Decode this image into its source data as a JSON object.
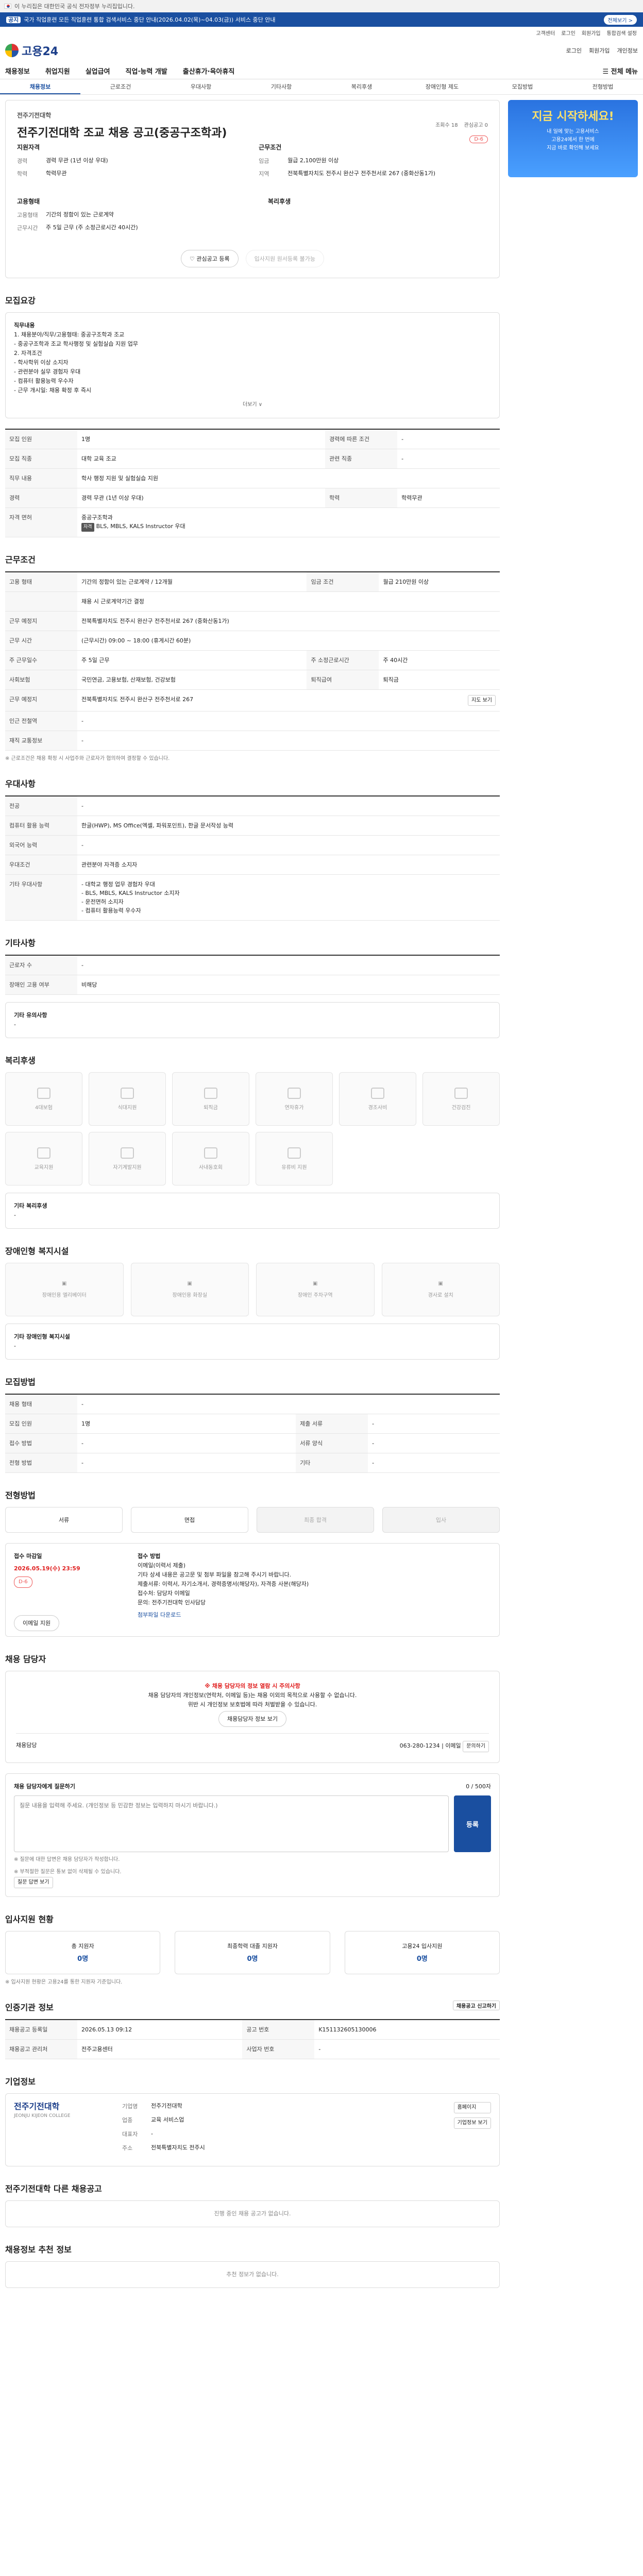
{
  "gov_bar": {
    "text": "이 누리집은 대한민국 공식 전자정부 누리집입니다."
  },
  "notice": {
    "tag": "공지",
    "text": "국가 직업훈련 모든 직업훈련 통합 검색서비스 중단 안내(2026.04.02(목)~04.03(금)) 서비스 중단 안내",
    "btn": "전체보기 >"
  },
  "util": [
    "고객센터",
    "로그인",
    "회원가입",
    "통합검색 설정"
  ],
  "logo": "고용24",
  "header_right": [
    "로그인",
    "회원가입",
    "개인정보"
  ],
  "gnb": {
    "items": [
      "채용정보",
      "취업지원",
      "실업급여",
      "직업·능력 개발",
      "출산휴가·육아휴직"
    ],
    "all": "전체 메뉴"
  },
  "subnav": [
    "채용정보",
    "근로조건",
    "우대사항",
    "기타사항",
    "복리후생",
    "장애인형 제도",
    "모집방법",
    "전형방법"
  ],
  "side_banner": {
    "title": "지금 시작하세요!",
    "lines": [
      "내 일에 맞는 고용서비스",
      "고용24에서 한 번에",
      "지금 바로 확인해 보세요"
    ]
  },
  "job": {
    "company": "전주기전대학",
    "title": "전주기전대학 조교 채용 공고(중공구조학과)",
    "views_label": "조회수",
    "views": "18",
    "scrap_label": "관심공고",
    "scrap": "0",
    "dday": "D-6",
    "left_head": "지원자격",
    "right_head": "근무조건",
    "left": [
      {
        "k": "경력",
        "v": "경력 무관 (1년 이상 우대)"
      },
      {
        "k": "학력",
        "v": "학력무관"
      }
    ],
    "right": [
      {
        "k": "임금",
        "v": "월급 2,100만원 이상"
      },
      {
        "k": "지역",
        "v": "전북특별자치도 전주시 완산구 전주천서로 267 (중화산동1가)"
      }
    ],
    "left2_head": "고용형태",
    "right2_head": "복리후생",
    "left2": [
      {
        "k": "고용형태",
        "v": "기간의 정함이 있는 근로계약"
      },
      {
        "k": "근무시간",
        "v": "주 5일 근무 (주 소정근로시간 40시간)"
      }
    ],
    "actions": [
      "관심공고 등록",
      "입사지원 원서등록 불가능"
    ]
  },
  "recruit": {
    "title": "모집요강",
    "job_title": "직무내용",
    "lines": [
      "1. 채용분야/직무/고용형태: 중공구조학과 조교",
      "- 중공구조학과 조교 학사행정 및 실험실습 지원 업무",
      "2. 자격조건",
      "- 학사학위 이상 소지자",
      "- 관련분야 실무 경험자 우대",
      "- 컴퓨터 활용능력 우수자",
      "- 근무 개시일: 채용 확정 후 즉시"
    ],
    "more": "더보기 ∨"
  },
  "info_rows": [
    {
      "h": "모집 인원",
      "v": "1명",
      "h2": "경력에 따른 조건",
      "v2": "-"
    },
    {
      "h": "모집 직종",
      "v": "대학 교육 조교",
      "h2": "관련 직종",
      "v2": "-"
    },
    {
      "h": "직무 내용",
      "v": "학사 행정 지원 및 실험실습 지원",
      "h2": "",
      "v2": ""
    },
    {
      "h": "경력",
      "v": "경력 무관 (1년 이상 우대)",
      "h2": "학력",
      "v2": "학력무관"
    },
    {
      "h": "자격 면허",
      "v": "중공구조학과",
      "h2": "",
      "v2": ""
    }
  ],
  "info_sub": {
    "pill": "자격",
    "text": "BLS, MBLS, KALS Instructor 우대"
  },
  "cond": {
    "title": "근무조건",
    "rows": [
      {
        "h": "고용 형태",
        "v": "기간의 정함이 있는 근로계약 / 12개월",
        "h2": "임금 조건",
        "v2": "월급 210만원 이상"
      },
      {
        "h": "",
        "v": "채용 시 근로계약기간 결정",
        "h2": "",
        "v2": ""
      },
      {
        "h": "근무 예정지",
        "v": "전북특별자치도 전주시 완산구 전주천서로 267 (중화산동1가)",
        "h2": "",
        "v2": ""
      },
      {
        "h": "근무 시간",
        "v": "(근무시간) 09:00 ~ 18:00 (휴게시간 60분)",
        "h2": "",
        "v2": ""
      },
      {
        "h": "주 근무일수",
        "v": "주 5일 근무",
        "h2": "주 소정근로시간",
        "v2": "주 40시간"
      },
      {
        "h": "사회보험",
        "v": "국민연금, 고용보험, 산재보험, 건강보험",
        "h2": "퇴직급여",
        "v2": "퇴직금"
      },
      {
        "h": "근무 예정지",
        "v": "전북특별자치도 전주시 완산구 전주천서로 267",
        "h2": "",
        "v2": ""
      },
      {
        "h": "인근 전철역",
        "v": "-",
        "h2": "",
        "v2": ""
      },
      {
        "h": "재직 교통정보",
        "v": "-",
        "h2": "",
        "v2": ""
      }
    ],
    "note": "※ 근로조건은 채용 확정 시 사업주와 근로자가 협의하여 결정할 수 있습니다.",
    "map_btn": "지도 보기"
  },
  "pref": {
    "title": "우대사항",
    "rows": [
      {
        "h": "전공",
        "v": "-"
      },
      {
        "h": "컴퓨터 활용 능력",
        "v": "한글(HWP), MS Office(엑셀, 파워포인트), 한글 문서작성 능력"
      },
      {
        "h": "외국어 능력",
        "v": "-"
      },
      {
        "h": "우대조건",
        "v": "관련분야 자격증 소지자"
      },
      {
        "h": "기타 우대사항",
        "v": "- 대학교 행정 업무 경험자 우대\n- BLS, MBLS, KALS Instructor 소지자\n- 운전면허 소지자\n- 컴퓨터 활용능력 우수자"
      }
    ]
  },
  "etc": {
    "title": "기타사항",
    "rows": [
      {
        "h": "근로자 수",
        "v": "-"
      },
      {
        "h": "장애인 고용 여부",
        "v": "비해당"
      }
    ],
    "extra_title": "기타 유의사항",
    "extra_text": "-"
  },
  "benefit": {
    "title": "복리후생",
    "items": [
      "4대보험",
      "식대지원",
      "퇴직금",
      "연차휴가",
      "경조사비",
      "건강검진",
      "교육지원",
      "자기계발지원",
      "사내동호회",
      "유류비 지원"
    ],
    "note_title": "기타 복리후생",
    "note": "-"
  },
  "disabled": {
    "title": "장애인형 복지시설",
    "items": [
      "장애인용 엘리베이터",
      "장애인용 화장실",
      "장애인 주차구역",
      "경사로 설치"
    ],
    "note_title": "기타 장애인형 복지시설",
    "note": "-"
  },
  "method": {
    "title": "모집방법",
    "rows": [
      {
        "h": "채용 형태",
        "v": "-",
        "h2": "",
        "v2": ""
      },
      {
        "h": "모집 인원",
        "v": "1명",
        "h2": "제출 서류",
        "v2": "-"
      },
      {
        "h": "접수 방법",
        "v": "-",
        "h2": "서류 양식",
        "v2": "-"
      },
      {
        "h": "전형 방법",
        "v": "-",
        "h2": "기타",
        "v2": "-"
      }
    ]
  },
  "process": {
    "title": "전형방법",
    "steps": [
      "서류",
      "면접",
      "최종 합격",
      "입사"
    ]
  },
  "period": {
    "label": "접수 마감일",
    "date": "2026.05.19(수) 23:59",
    "dday": "D-6",
    "head": "접수 방법",
    "lines": [
      "이메일(이력서 제출)",
      "기타 상세 내용은 공고문 및 첨부 파일을 참고해 주시기 바랍니다.",
      "제출서류: 이력서, 자기소개서, 경력증명서(해당자), 자격증 사본(해당자)",
      "접수처: 담당자 이메일",
      "문의: 전주기전대학 인사담당"
    ],
    "btn": "이메일 지원",
    "link": "첨부파일 다운로드"
  },
  "warn": {
    "title": "채용 담당자",
    "warn_text": "※ 채용 담당자의 정보 열람 시 주의사항",
    "body": "채용 담당자의 개인정보(연락처, 이메일 등)는 채용 이외의 목적으로 사용할 수 없습니다.",
    "sub": "위반 시 개인정보 보호법에 따라 처벌받을 수 있습니다.",
    "btn": "채용담당자 정보 보기",
    "mgr_label": "채용담당",
    "mgr_phone": "063-280-1234",
    "mgr_email_label": "이메일",
    "mgr_btn": "문의하기"
  },
  "ask": {
    "title": "채용 담당자에게 질문하기",
    "placeholder": "질문 내용을 입력해 주세요. (개인정보 등 민감한 정보는 입력하지 마시기 바랍니다.)",
    "count": "0 / 500자",
    "send": "등록",
    "notes": [
      "※ 질문에 대한 답변은 채용 담당자가 작성합니다.",
      "※ 부적절한 질문은 통보 없이 삭제될 수 있습니다."
    ],
    "btn2": "질문 답변 보기"
  },
  "stats": {
    "title": "입사지원 현황",
    "items": [
      {
        "k": "총 지원자",
        "v": "0명"
      },
      {
        "k": "최종학력 대졸 지원자",
        "v": "0명"
      },
      {
        "k": "고용24 입사지원",
        "v": "0명"
      }
    ],
    "note": "※ 입사지원 현황은 고용24를 통한 지원자 기준입니다."
  },
  "source": {
    "title": "인증기관 정보",
    "rows": [
      {
        "h": "채용공고 등록일",
        "v": "2026.05.13 09:12",
        "h2": "공고 번호",
        "v2": "K151132605130006"
      },
      {
        "h": "채용공고 관리처",
        "v": "전주고용센터",
        "h2": "사업자 번호",
        "v2": "-"
      }
    ],
    "btn": "채용공고 신고하기"
  },
  "company": {
    "title": "기업정보",
    "name": "전주기전대학",
    "en": "JEONJU KIJEON COLLEGE",
    "rows": [
      {
        "k": "기업명",
        "v": "전주기전대학"
      },
      {
        "k": "업종",
        "v": "교육 서비스업"
      },
      {
        "k": "대표자",
        "v": "-"
      },
      {
        "k": "주소",
        "v": "전북특별자치도 전주시"
      }
    ],
    "btns": [
      "홈페이지",
      "기업정보 보기"
    ]
  },
  "same": {
    "title": "전주기전대학 다른 채용공고",
    "text": "진행 중인 채용 공고가 없습니다."
  },
  "rec": {
    "title": "채용정보 추천 정보",
    "text": "추천 정보가 없습니다."
  }
}
